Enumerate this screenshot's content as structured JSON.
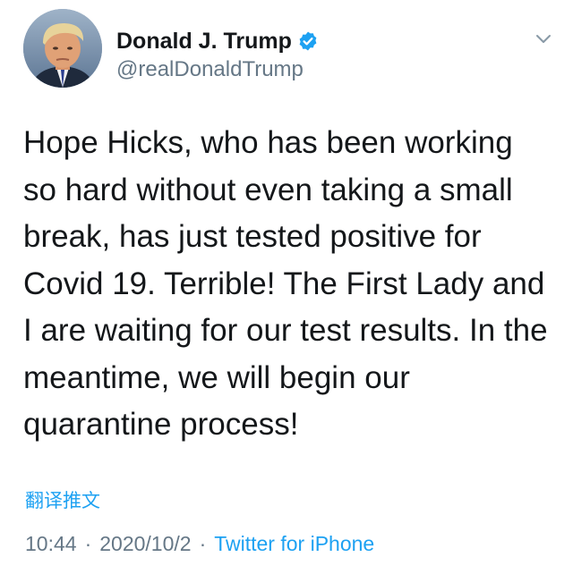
{
  "author": {
    "display_name": "Donald J. Trump",
    "handle": "@realDonaldTrump",
    "verified": true,
    "avatar_icon": "profile-photo"
  },
  "tweet": {
    "text": "Hope Hicks, who has been working\nso hard without even taking a small\nbreak, has just tested positive for\nCovid 19. Terrible! The First Lady and\nI are waiting for our test results. In the\nmeantime, we will begin our\nquarantine process!",
    "translate_label": "翻译推文",
    "time": "10:44",
    "date": "2020/10/2",
    "separator": "·",
    "source": "Twitter for iPhone"
  },
  "colors": {
    "accent": "#1da1f2",
    "secondary_text": "#657786",
    "primary_text": "#14171a"
  },
  "icons": {
    "verified": "verified-badge-icon",
    "menu": "chevron-down-icon"
  }
}
